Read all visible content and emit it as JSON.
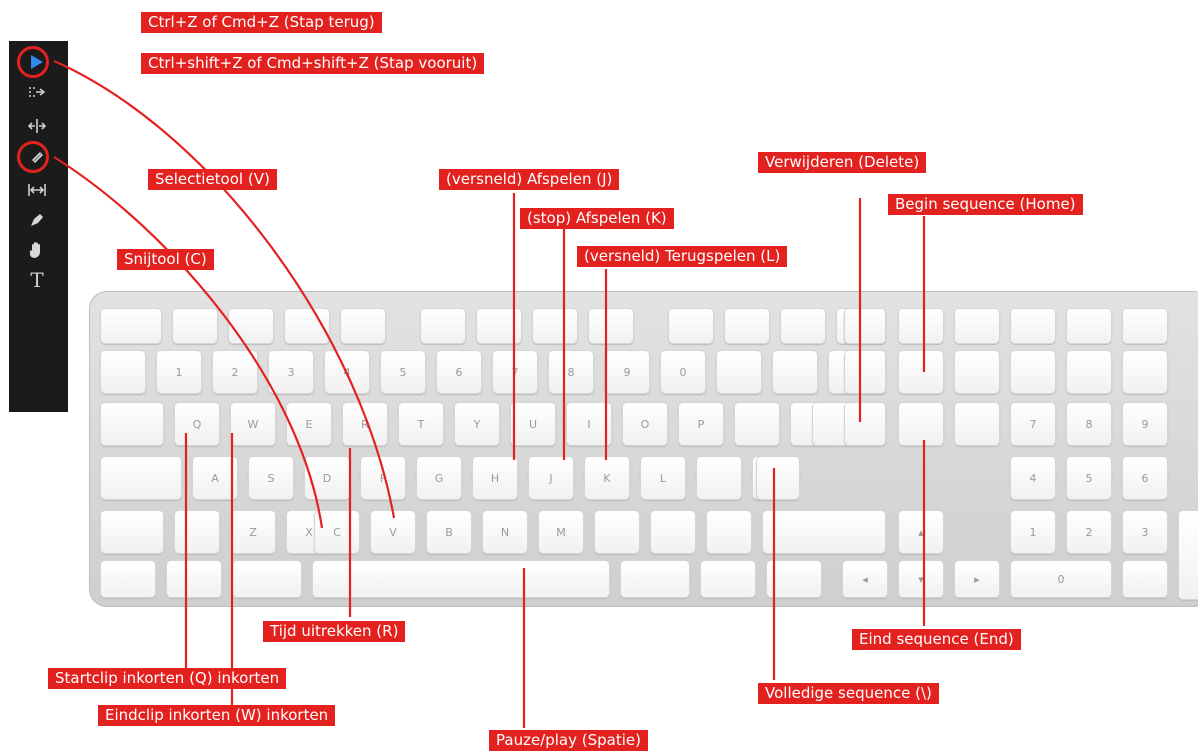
{
  "colors": {
    "accent": "#e3211f",
    "toolbar": "#1b1b1b",
    "tool_active": "#2d8ceb"
  },
  "toolbar": {
    "tools": [
      {
        "icon": "selection-arrow-icon"
      },
      {
        "icon": "track-select-icon"
      },
      {
        "icon": "ripple-edit-icon"
      },
      {
        "icon": "razor-icon"
      },
      {
        "icon": "slip-icon"
      },
      {
        "icon": "pen-icon"
      },
      {
        "icon": "hand-icon"
      },
      {
        "icon": "type-icon",
        "glyph": "T"
      }
    ]
  },
  "labels": {
    "undo": "Ctrl+Z of Cmd+Z (Stap terug)",
    "redo": "Ctrl+shift+Z of Cmd+shift+Z (Stap vooruit)",
    "selection": "Selectietool (V)",
    "razor": "Snijtool (C)",
    "play_fast": "(versneld) Afspelen (J)",
    "stop": "(stop) Afspelen (K)",
    "reverse_fast": "(versneld) Terugspelen (L)",
    "delete": "Verwijderen (Delete)",
    "home": "Begin sequence (Home)",
    "rate_stretch": "Tijd uitrekken (R)",
    "trim_start": "Startclip inkorten (Q) inkorten",
    "trim_end": "Eindclip inkorten (W) inkorten",
    "end": "Eind sequence (End)",
    "full_sequence": "Volledige sequence  (\\)",
    "play_pause": "Pauze/play (Spatie)"
  },
  "keyboard": {
    "keys": {
      "q": "Q",
      "w": "W",
      "e": "E",
      "r": "R",
      "t": "T",
      "y": "Y",
      "u": "U",
      "i": "I",
      "o": "O",
      "p": "P",
      "a": "A",
      "s": "S",
      "d": "D",
      "f": "F",
      "g": "G",
      "h": "H",
      "j": "J",
      "k": "K",
      "l": "L",
      "z": "Z",
      "x": "X",
      "c": "C",
      "v": "V",
      "b": "B",
      "n": "N",
      "m": "M",
      "n1": "1",
      "n2": "2",
      "n3": "3",
      "n4": "4",
      "n5": "5",
      "n6": "6",
      "n7": "7",
      "n8": "8",
      "n9": "9",
      "n0": "0",
      "kp7": "7",
      "kp8": "8",
      "kp9": "9",
      "kp4": "4",
      "kp5": "5",
      "kp6": "6",
      "kp1": "1",
      "kp2": "2",
      "kp3": "3",
      "kp0": "0",
      "left": "◂",
      "right": "▸",
      "up": "▴",
      "down": "▾"
    }
  }
}
